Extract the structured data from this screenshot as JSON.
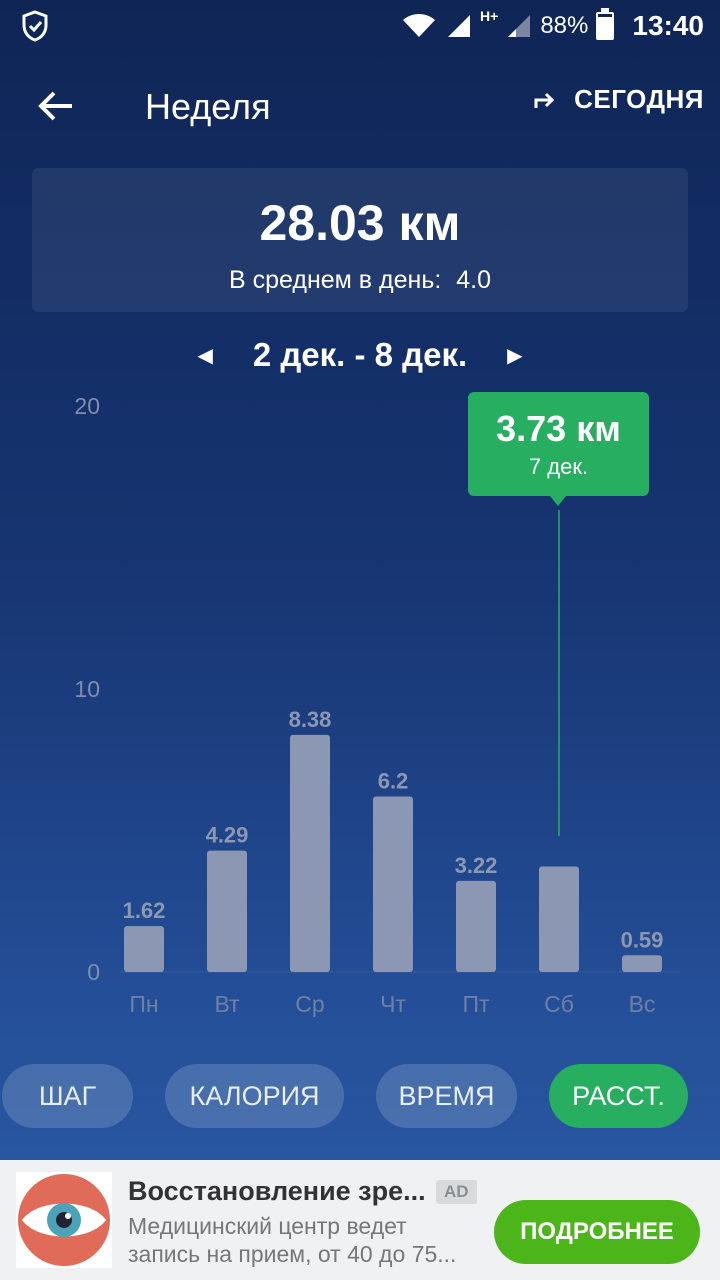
{
  "status": {
    "battery": "88%",
    "battery_level": 0.88,
    "time": "13:40",
    "network": "H+"
  },
  "toolbar": {
    "title": "Неделя",
    "today_label": "СЕГОДНЯ"
  },
  "summary": {
    "total": "28.03 км",
    "avg_label": "В среднем в день:",
    "avg_value": "4.0"
  },
  "range": {
    "label": "2 дек. - 8 дек."
  },
  "tooltip": {
    "value": "3.73 км",
    "date": "7 дек."
  },
  "chart_data": {
    "type": "bar",
    "categories": [
      "Пн",
      "Вт",
      "Ср",
      "Чт",
      "Пт",
      "Сб",
      "Вс"
    ],
    "values": [
      1.62,
      4.29,
      8.38,
      6.2,
      3.22,
      3.73,
      0.59
    ],
    "value_labels": [
      "1.62",
      "4.29",
      "8.38",
      "6.2",
      "3.22",
      "",
      "0.59"
    ],
    "yticks": [
      "0",
      "10",
      "20"
    ],
    "ylim": [
      0,
      20
    ],
    "highlight_index": 5,
    "bar_color": "#8c98b3",
    "highlight_color": "#27ae60"
  },
  "metric_tabs": [
    {
      "label": "ШАГ",
      "active": false
    },
    {
      "label": "КАЛОРИЯ",
      "active": false
    },
    {
      "label": "ВРЕМЯ",
      "active": false
    },
    {
      "label": "РАССТ.",
      "active": true
    }
  ],
  "ad": {
    "title": "Восстановление зре...",
    "badge": "AD",
    "description": "Медицинский центр ведет запись на прием, от 40 до 75...",
    "button": "ПОДРОБНЕЕ"
  }
}
